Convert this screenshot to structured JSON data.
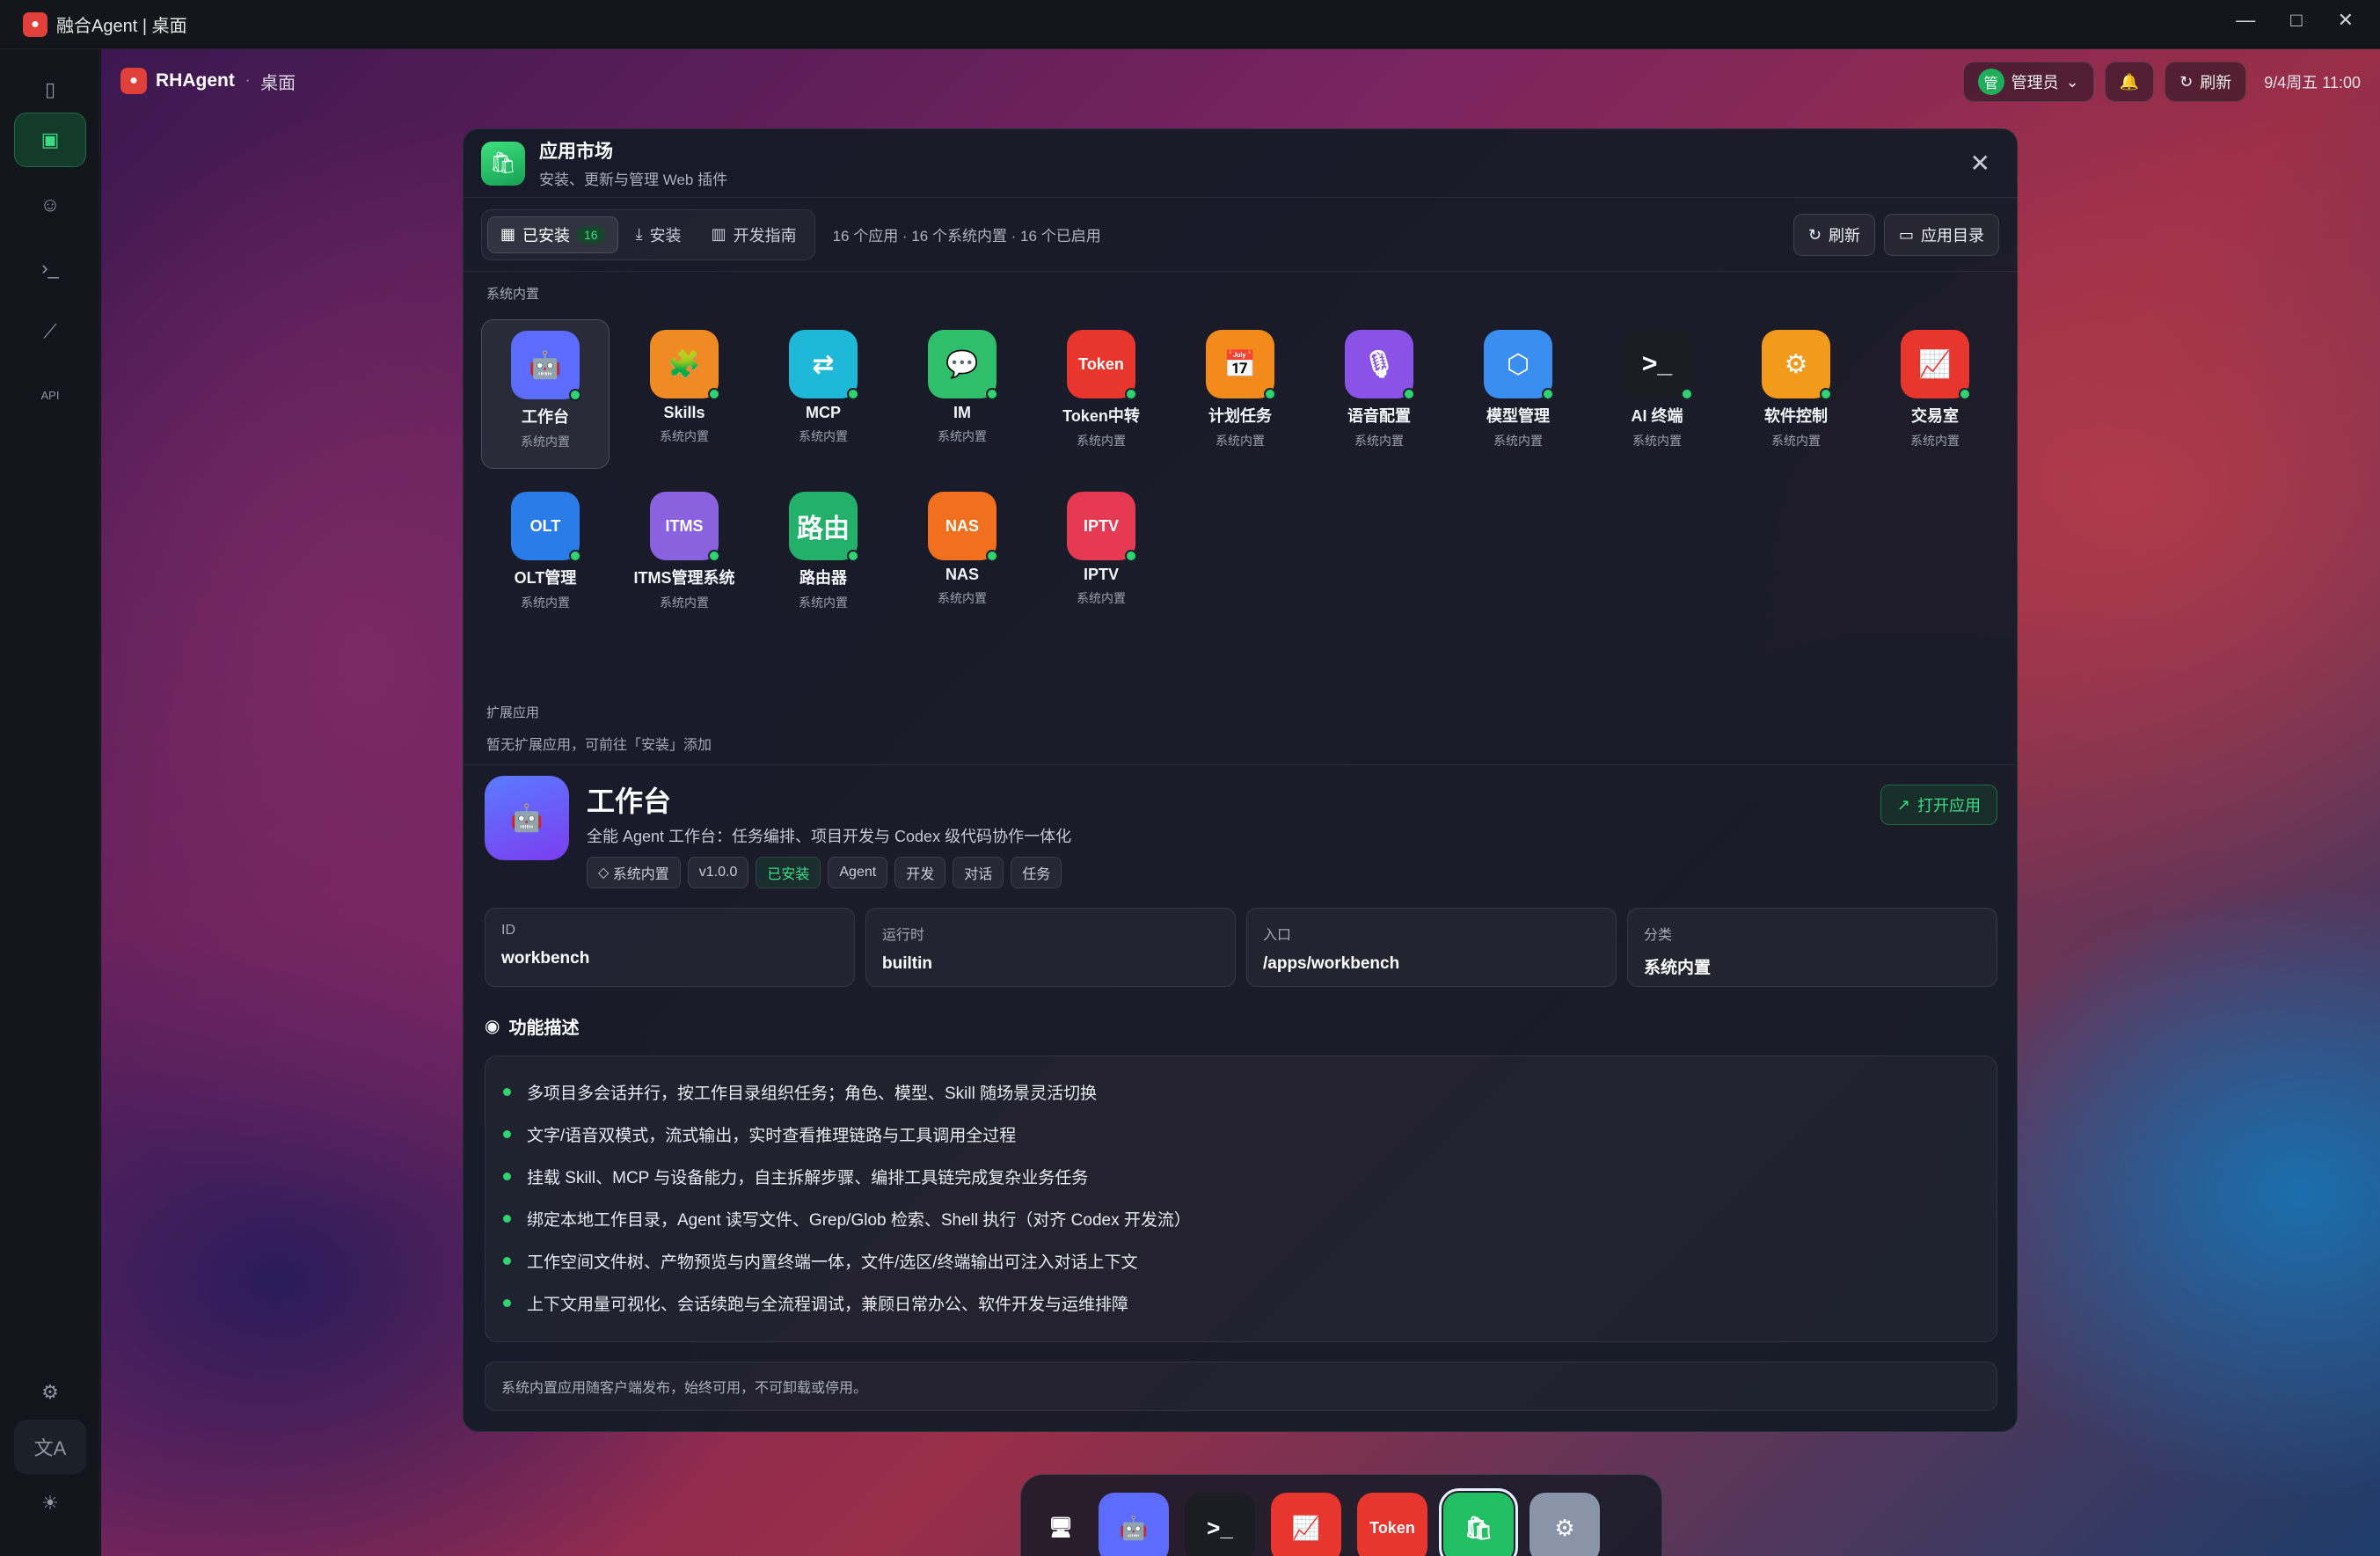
{
  "window": {
    "title": "融合Agent | 桌面"
  },
  "topbar": {
    "app": "RHAgent",
    "sep": "·",
    "crumb": "桌面",
    "user": "管理员",
    "avatar": "管",
    "refresh": "刷新",
    "datetime": "9/4周五 11:00"
  },
  "leftbar": {
    "items": [
      "desktop-icon",
      "robot-icon",
      "terminal-icon",
      "chart-icon",
      "api-icon"
    ],
    "api_label": "API"
  },
  "panel": {
    "title": "应用市场",
    "subtitle": "安装、更新与管理 Web 插件",
    "tabs": [
      {
        "label": "已安装",
        "badge": "16"
      },
      {
        "label": "安装"
      },
      {
        "label": "开发指南"
      }
    ],
    "stats": "16 个应用 · 16 个系统内置 · 16 个已启用",
    "refresh": "刷新",
    "app_dir": "应用目录",
    "section_builtin": "系统内置",
    "apps": [
      {
        "name": "工作台",
        "sub": "系统内置",
        "glyph": "🤖",
        "color": "#5b6cff"
      },
      {
        "name": "Skills",
        "sub": "系统内置",
        "glyph": "🧩",
        "color": "#f08a24"
      },
      {
        "name": "MCP",
        "sub": "系统内置",
        "glyph": "⇄",
        "color": "#20b8d8"
      },
      {
        "name": "IM",
        "sub": "系统内置",
        "glyph": "💬",
        "color": "#2fbf6a"
      },
      {
        "name": "Token中转",
        "sub": "系统内置",
        "glyph": "Token",
        "color": "#e8362e"
      },
      {
        "name": "计划任务",
        "sub": "系统内置",
        "glyph": "📅",
        "color": "#f28a1c"
      },
      {
        "name": "语音配置",
        "sub": "系统内置",
        "glyph": "🎙",
        "color": "#8a52e6"
      },
      {
        "name": "模型管理",
        "sub": "系统内置",
        "glyph": "⬡",
        "color": "#3a8ef0"
      },
      {
        "name": "AI 终端",
        "sub": "系统内置",
        "glyph": ">_",
        "color": "#1b1d22"
      },
      {
        "name": "软件控制",
        "sub": "系统内置",
        "glyph": "⚙",
        "color": "#f29a1c"
      },
      {
        "name": "交易室",
        "sub": "系统内置",
        "glyph": "📈",
        "color": "#e8362e"
      },
      {
        "name": "OLT管理",
        "sub": "系统内置",
        "glyph": "OLT",
        "color": "#2a7ce8"
      },
      {
        "name": "ITMS管理系统",
        "sub": "系统内置",
        "glyph": "ITMS",
        "color": "#8a62e0"
      },
      {
        "name": "路由器",
        "sub": "系统内置",
        "glyph": "路由",
        "color": "#22b06a"
      },
      {
        "name": "NAS",
        "sub": "系统内置",
        "glyph": "NAS",
        "color": "#f07020"
      },
      {
        "name": "IPTV",
        "sub": "系统内置",
        "glyph": "IPTV",
        "color": "#e63a52"
      }
    ],
    "section_ext": "扩展应用",
    "ext_empty": "暂无扩展应用，可前往「安装」添加",
    "detail": {
      "title": "工作台",
      "desc": "全能 Agent 工作台：任务编排、项目开发与 Codex 级代码协作一体化",
      "open": "打开应用",
      "tags": [
        "系统内置",
        "v1.0.0",
        "已安装",
        "Agent",
        "开发",
        "对话",
        "任务"
      ],
      "cards": [
        {
          "k": "ID",
          "v": "workbench"
        },
        {
          "k": "运行时",
          "v": "builtin"
        },
        {
          "k": "入口",
          "v": "/apps/workbench"
        },
        {
          "k": "分类",
          "v": "系统内置"
        }
      ],
      "features_title": "功能描述",
      "features": [
        "多项目多会话并行，按工作目录组织任务；角色、模型、Skill 随场景灵活切换",
        "文字/语音双模式，流式输出，实时查看推理链路与工具调用全过程",
        "挂载 Skill、MCP 与设备能力，自主拆解步骤、编排工具链完成复杂业务任务",
        "绑定本地工作目录，Agent 读写文件、Grep/Glob 检索、Shell 执行（对齐 Codex 开发流）",
        "工作空间文件树、产物预览与内置终端一体，文件/选区/终端输出可注入对话上下文",
        "上下文用量可视化、会话续跑与全流程调试，兼顾日常办公、软件开发与运维排障"
      ],
      "note": "系统内置应用随客户端发布，始终可用，不可卸载或停用。"
    }
  },
  "dock": {
    "items": [
      {
        "name": "desktop",
        "glyph": "🖥",
        "color": "transparent"
      },
      {
        "name": "workbench",
        "glyph": "🤖",
        "color": "#5b6cff"
      },
      {
        "name": "ai-terminal",
        "glyph": ">_",
        "color": "#1b1d22"
      },
      {
        "name": "trading",
        "glyph": "📈",
        "color": "#e8362e"
      },
      {
        "name": "token",
        "glyph": "Token",
        "color": "#e8362e"
      },
      {
        "name": "app-market",
        "glyph": "🛍",
        "color": "#22c063"
      },
      {
        "name": "settings",
        "glyph": "⚙",
        "color": "#8a94a8"
      }
    ]
  }
}
